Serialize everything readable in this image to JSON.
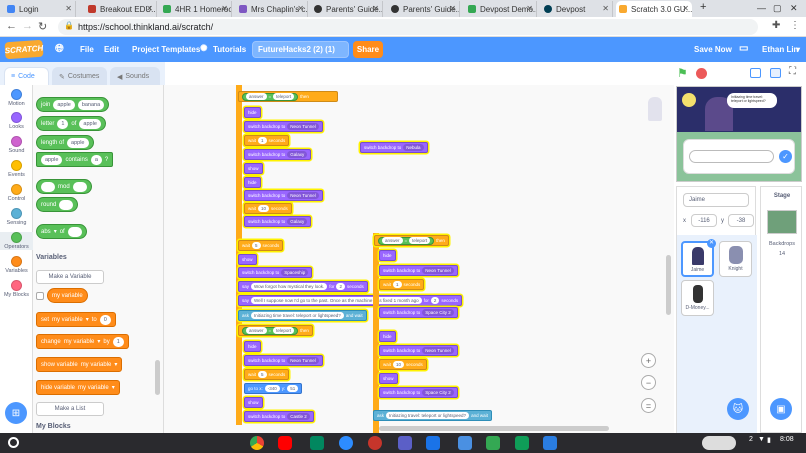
{
  "browser": {
    "tabs": [
      {
        "title": "Login",
        "color": "#4285f4"
      },
      {
        "title": "Breakout EDU...",
        "color": "#c0392b"
      },
      {
        "title": "4HR 1 Homeroo...",
        "color": "#34a853"
      },
      {
        "title": "Mrs Chaplin's c...",
        "color": "#7e57c2"
      },
      {
        "title": "Parents' Guide...",
        "color": "#333333"
      },
      {
        "title": "Parents' Guide...",
        "color": "#333333"
      },
      {
        "title": "Devpost Demo...",
        "color": "#34a853"
      },
      {
        "title": "Devpost",
        "color": "#003e54"
      },
      {
        "title": "Scratch 3.0 GU...",
        "color": "#f9a92f"
      }
    ],
    "new_tab": "+",
    "url": "https://school.thinkland.ai/scratch/"
  },
  "scratch_menu": {
    "logo": "SCRATCH",
    "file": "File",
    "edit": "Edit",
    "project_templates": "Project Templates",
    "tutorials": "Tutorials",
    "project_title": "FutureHacks2 (2) (1)",
    "share": "Share",
    "save_now": "Save Now",
    "user": "Ethan Lin"
  },
  "editor_tabs": {
    "code": "Code",
    "costumes": "Costumes",
    "sounds": "Sounds"
  },
  "categories": [
    {
      "label": "Motion",
      "color": "#4c97ff"
    },
    {
      "label": "Looks",
      "color": "#9966ff"
    },
    {
      "label": "Sound",
      "color": "#cf63cf"
    },
    {
      "label": "Events",
      "color": "#ffbf00"
    },
    {
      "label": "Control",
      "color": "#ffab19"
    },
    {
      "label": "Sensing",
      "color": "#5cb1d6"
    },
    {
      "label": "Operators",
      "color": "#59c059"
    },
    {
      "label": "Variables",
      "color": "#ff8c1a"
    },
    {
      "label": "My Blocks",
      "color": "#ff6680"
    }
  ],
  "palette": {
    "join": "join",
    "join_a": "apple",
    "join_b": "banana",
    "letter": "letter",
    "letter_n": "1",
    "letter_of": "of",
    "letter_str": "apple",
    "length_of": "length of",
    "length_str": "apple",
    "contains_a": "apple",
    "contains": "contains",
    "contains_b": "a",
    "contains_q": "?",
    "mod": "mod",
    "round": "round",
    "abs": "abs",
    "abs_of": "of",
    "variables_heading": "Variables",
    "make_variable": "Make a Variable",
    "my_variable": "my variable",
    "set": "set",
    "set_var": "my variable",
    "set_to": "to",
    "set_val": "0",
    "change": "change",
    "change_var": "my variable",
    "change_by": "by",
    "change_val": "1",
    "show_variable": "show variable",
    "show_var": "my variable",
    "hide_variable": "hide variable",
    "hide_var": "my variable",
    "make_list": "Make a List",
    "my_blocks_heading": "My Blocks"
  },
  "code": {
    "answer": "answer",
    "equals": "=",
    "teleport": "teleport",
    "then": "then",
    "hide": "hide",
    "show": "show",
    "switch_backdrop": "switch backdrop to",
    "neon_tunnel": "Neon Tunnel",
    "galaxy": "Galaxy",
    "nebula": "Nebula",
    "spaceship": "Spaceship",
    "space_city_2": "Space City 2",
    "castle_2": "Castle 2",
    "wait": "wait",
    "seconds": "seconds",
    "w1": "1",
    "w10": "10",
    "w5": "5",
    "w2": "2",
    "say": "say",
    "for": "for",
    "say1": "Wow forgot how mystical they look.",
    "say2": "Well I suppose now I'd go to the past. Once as the machine was fixed 1 month ago",
    "ask": "ask",
    "and_wait": "and wait",
    "ask_text": "Initiazing time travel: teleport or lightspeed?",
    "ask_text_b": "Initiazing travel: teleport or lightspeed?",
    "go_to": "go to x:",
    "y": "y:",
    "gx": "-340",
    "gy": "51"
  },
  "stage": {
    "speech": "Initiazing time travel: teleport or lightspeed?"
  },
  "sprite_info": {
    "name": "Jaime",
    "x_label": "x",
    "x": "-116",
    "y_label": "y",
    "y": "-38"
  },
  "sprites": [
    "Jaime",
    "Knight",
    "D-Money..."
  ],
  "stage_panel": {
    "title": "Stage",
    "backdrops_label": "Backdrops",
    "backdrops_count": "14"
  },
  "taskbar": {
    "battery": "2",
    "time": "8:08"
  }
}
